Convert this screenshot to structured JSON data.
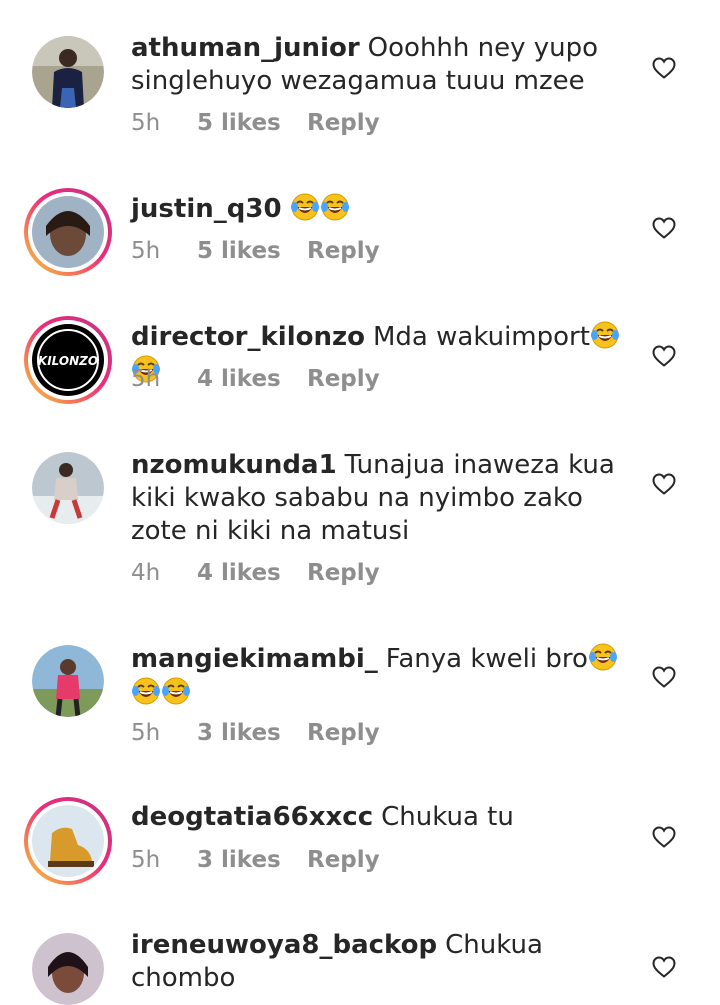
{
  "colors": {
    "text": "#262626",
    "meta": "#8e8e8e",
    "ring_start": "#f9ce34",
    "ring_end": "#c13584"
  },
  "comments": [
    {
      "username": "athuman_junior",
      "text": "Ooohhh ney yupo singlehuyo wezagamua tuuu mzee",
      "time": "5h",
      "likes": "5 likes",
      "reply": "Reply"
    },
    {
      "username": "justin_q30",
      "text": "",
      "time": "5h",
      "likes": "5 likes",
      "reply": "Reply"
    },
    {
      "username": "director_kilonzo",
      "text": "Mda wakuimport",
      "time": "5h",
      "likes": "4 likes",
      "reply": "Reply",
      "avatar_logo_text": "KILONZO"
    },
    {
      "username": "nzomukunda1",
      "text": "Tunajua inaweza kua kiki kwako sababu na nyimbo zako zote ni kiki na matusi",
      "time": "4h",
      "likes": "4 likes",
      "reply": "Reply"
    },
    {
      "username": "mangiekimambi_",
      "text": "Fanya kweli bro",
      "time": "5h",
      "likes": "3 likes",
      "reply": "Reply"
    },
    {
      "username": "deogtatia66xxcc",
      "text": "Chukua tu",
      "time": "5h",
      "likes": "3 likes",
      "reply": "Reply"
    },
    {
      "username": "ireneuwoya8_backop",
      "text": "Chukua chombo",
      "time": "",
      "likes": "",
      "reply": ""
    }
  ],
  "icons": {
    "like": "heart-outline-icon",
    "emoji": "face-with-tears-of-joy-icon"
  }
}
